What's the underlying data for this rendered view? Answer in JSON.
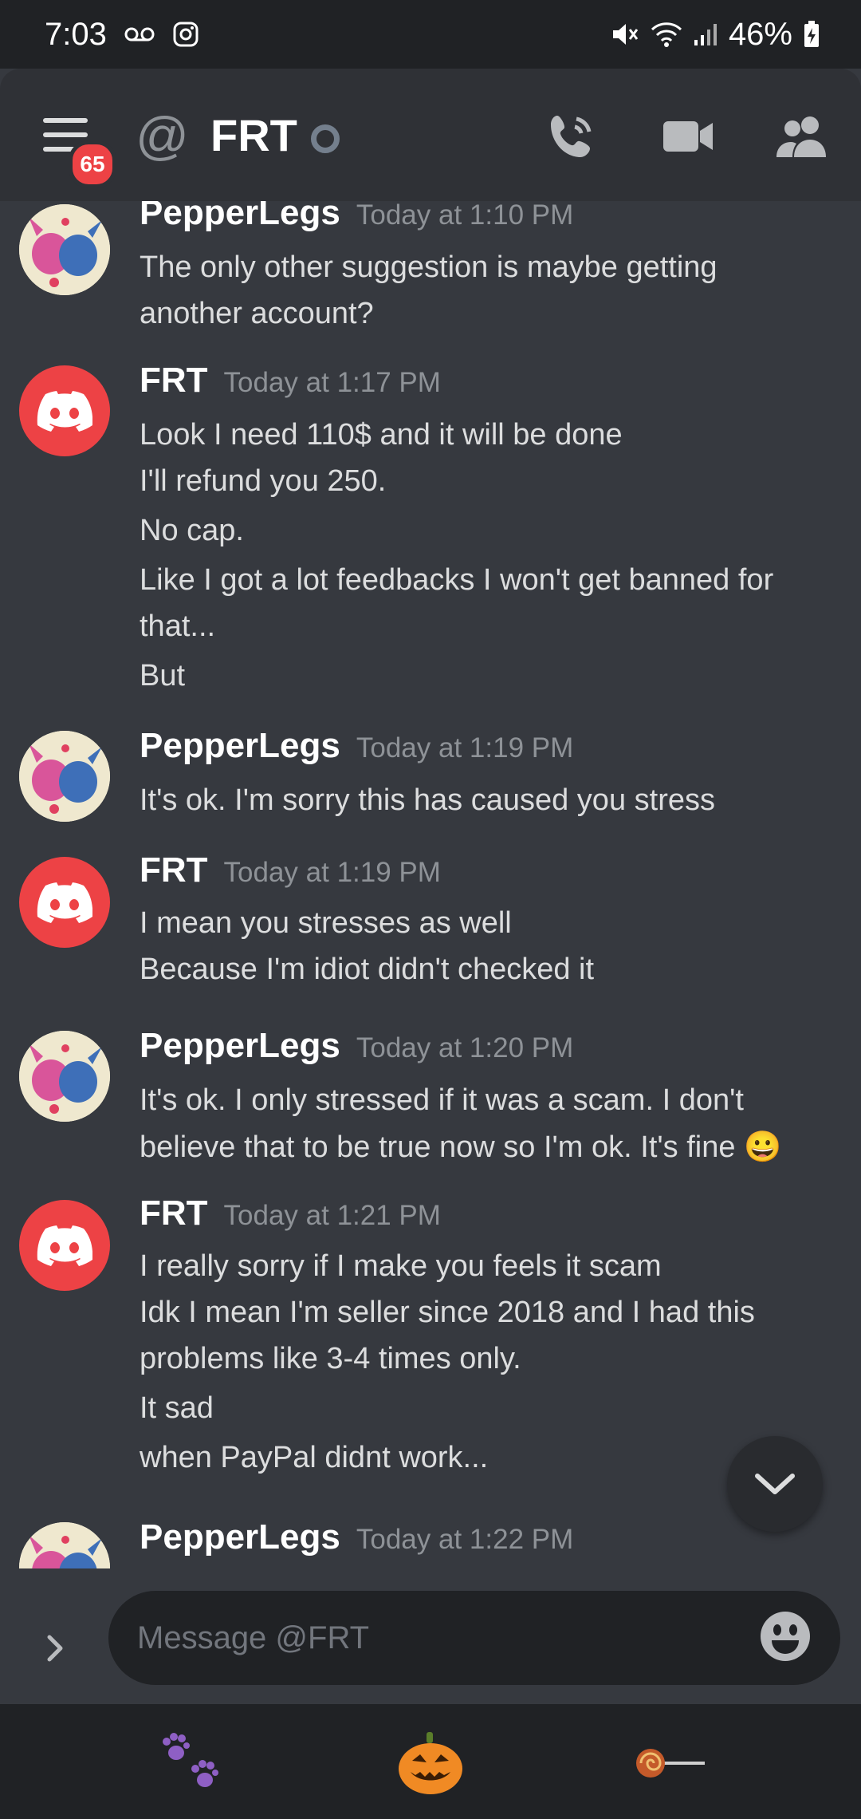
{
  "status_bar": {
    "time": "7:03",
    "battery": "46%"
  },
  "header": {
    "unread_badge": "65",
    "channel_name": "FRT"
  },
  "messages": [
    {
      "author": "PepperLegs",
      "timestamp": "Today at 1:10 PM",
      "avatar": "stitch-angel-avatar",
      "lines": [
        "The only other suggestion is maybe getting",
        "another account?"
      ]
    },
    {
      "author": "FRT",
      "timestamp": "Today at 1:17 PM",
      "avatar": "discord-logo-avatar",
      "lines": [
        "Look I need 110$ and it will be done",
        "I'll refund you 250.",
        "No cap.",
        "Like I got a lot feedbacks I won't get banned for",
        "that...",
        "But"
      ]
    },
    {
      "author": "PepperLegs",
      "timestamp": "Today at 1:19 PM",
      "avatar": "stitch-angel-avatar",
      "lines": [
        "It's ok. I'm sorry this has caused you stress"
      ]
    },
    {
      "author": "FRT",
      "timestamp": "Today at 1:19 PM",
      "avatar": "discord-logo-avatar",
      "lines": [
        "I mean you stresses as well",
        "Because I'm idiot didn't checked it"
      ]
    },
    {
      "author": "PepperLegs",
      "timestamp": "Today at 1:20 PM",
      "avatar": "stitch-angel-avatar",
      "lines": [
        "It's ok. I only stressed if it was a scam. I don't",
        "believe that to be true now so I'm ok. It's fine 😀"
      ]
    },
    {
      "author": "FRT",
      "timestamp": "Today at 1:21 PM",
      "avatar": "discord-logo-avatar",
      "lines": [
        "I really sorry if I make you feels it scam",
        "Idk I mean I'm seller since 2018 and I had this",
        "problems like 3-4 times only.",
        "It sad",
        "when PayPal didnt work..."
      ]
    },
    {
      "author": "PepperLegs",
      "timestamp": "Today at 1:22 PM",
      "avatar": "stitch-angel-avatar",
      "lines": []
    }
  ],
  "composer": {
    "placeholder": "Message @FRT"
  },
  "dock": {
    "items": [
      "paw-prints-icon",
      "jack-o-lantern-icon",
      "lollipop-icon"
    ]
  },
  "colors": {
    "background": "#36393f",
    "header": "#2f3136",
    "accent_red": "#ed4245",
    "text": "#dcddde",
    "muted": "#8e9297"
  }
}
